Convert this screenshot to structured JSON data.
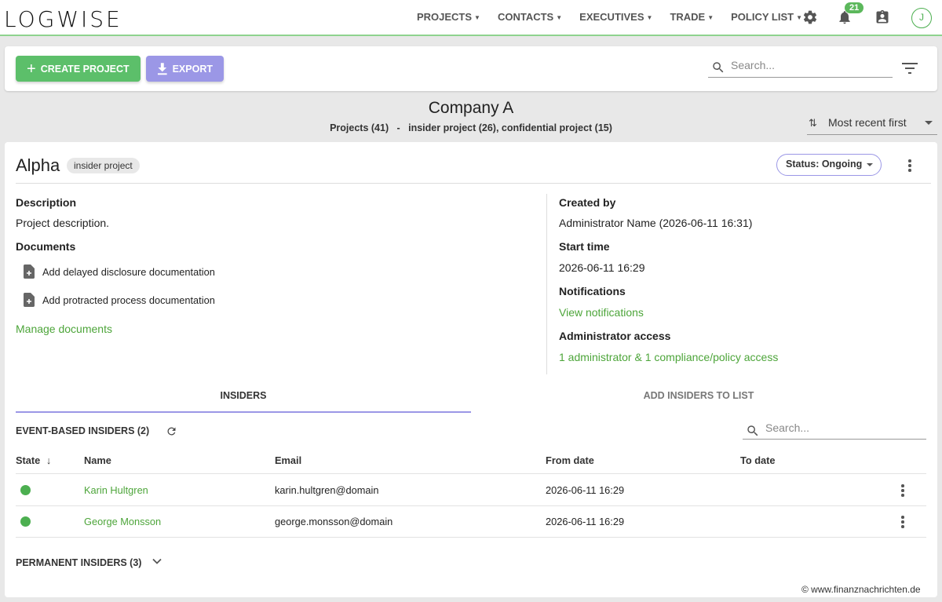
{
  "brand": {
    "logo": "LOGWISE"
  },
  "nav": {
    "items": [
      {
        "label": "PROJECTS"
      },
      {
        "label": "CONTACTS"
      },
      {
        "label": "EXECUTIVES"
      },
      {
        "label": "TRADE"
      },
      {
        "label": "POLICY LIST"
      }
    ],
    "notifications_count": "21",
    "avatar_initial": "J"
  },
  "toolbar": {
    "create_label": "CREATE PROJECT",
    "export_label": "EXPORT",
    "search_placeholder": "Search..."
  },
  "heading": {
    "company": "Company A",
    "summary": "Projects (41)   -   insider project (26), confidential project (15)",
    "sort_label": "Most recent first"
  },
  "project": {
    "name": "Alpha",
    "type_chip": "insider project",
    "status_label": "Status: Ongoing",
    "description_label": "Description",
    "description": "Project description.",
    "documents_label": "Documents",
    "documents": [
      {
        "label": "Add delayed disclosure documentation"
      },
      {
        "label": "Add protracted process documentation"
      }
    ],
    "manage_documents": "Manage documents",
    "created_by_label": "Created by",
    "created_by": "Administrator Name (2026-06-11 16:31)",
    "start_time_label": "Start time",
    "start_time": "2026-06-11 16:29",
    "notifications_label": "Notifications",
    "view_notifications": "View notifications",
    "admin_access_label": "Administrator access",
    "admin_access": "1 administrator & 1 compliance/policy access"
  },
  "tabs": {
    "insiders": "INSIDERS",
    "add_insiders": "ADD INSIDERS TO LIST"
  },
  "insiders": {
    "event_based_title": "EVENT-BASED INSIDERS (2)",
    "search_placeholder": "Search...",
    "columns": {
      "state": "State",
      "name": "Name",
      "email": "Email",
      "from_date": "From date",
      "to_date": "To date"
    },
    "rows": [
      {
        "name": "Karin Hultgren",
        "email": "karin.hultgren@domain",
        "from_date": "2026-06-11 16:29",
        "to_date": "",
        "state_color": "#4caf50"
      },
      {
        "name": "George Monsson",
        "email": "george.monsson@domain",
        "from_date": "2026-06-11 16:29",
        "to_date": "",
        "state_color": "#4caf50"
      }
    ],
    "permanent_title": "PERMANENT INSIDERS (3)"
  },
  "watermark": "© www.finanznachrichten.de",
  "colors": {
    "accent_green": "#5cbf6a",
    "accent_purple": "#9b97e6",
    "link_green": "#4da53a"
  }
}
